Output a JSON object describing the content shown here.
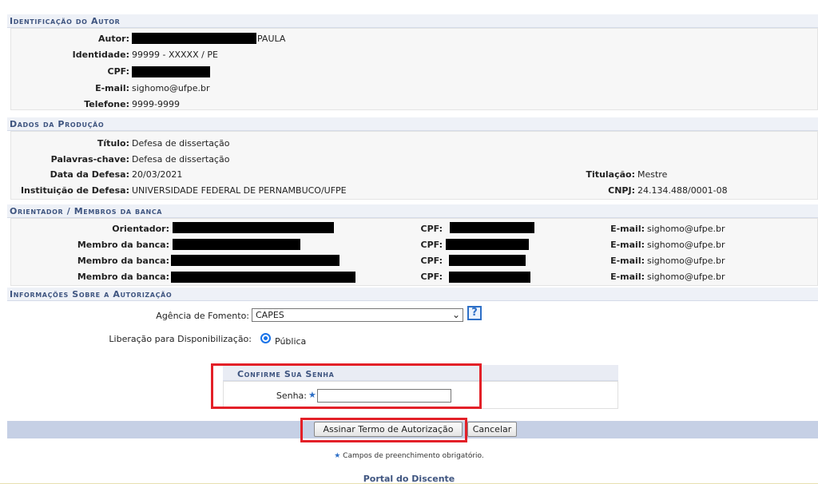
{
  "sections": {
    "author": "Identificação do Autor",
    "production": "Dados da Produção",
    "advisor": "Orientador / Membros da banca",
    "authorization": "Informações Sobre a Autorização"
  },
  "author": {
    "autor_label": "Autor:",
    "autor_value": "PAULA",
    "identidade_label": "Identidade:",
    "identidade_value": "99999 - XXXXX / PE",
    "cpf_label": "CPF:",
    "email_label": "E-mail:",
    "email_value": "sighomo@ufpe.br",
    "telefone_label": "Telefone:",
    "telefone_value": "9999-9999"
  },
  "production": {
    "titulo_label": "Título:",
    "titulo_value": "Defesa de dissertação",
    "palavras_label": "Palavras-chave:",
    "palavras_value": "Defesa de dissertação",
    "data_label": "Data da Defesa:",
    "data_value": "20/03/2021",
    "titulacao_label": "Titulação:",
    "titulacao_value": "Mestre",
    "instituicao_label": "Instituição de Defesa:",
    "instituicao_value": "UNIVERSIDADE FEDERAL DE PERNAMBUCO/UFPE",
    "cnpj_label": "CNPJ:",
    "cnpj_value": "24.134.488/0001-08"
  },
  "members": [
    {
      "role": "Orientador:",
      "cpf_label": "CPF:",
      "email_label": "E-mail:",
      "email": "sighomo@ufpe.br"
    },
    {
      "role": "Membro da banca:",
      "cpf_label": "CPF:",
      "email_label": "E-mail:",
      "email": "sighomo@ufpe.br"
    },
    {
      "role": "Membro da banca:",
      "cpf_label": "CPF:",
      "email_label": "E-mail:",
      "email": "sighomo@ufpe.br"
    },
    {
      "role": "Membro da banca:",
      "cpf_label": "CPF:",
      "email_label": "E-mail:",
      "email": "sighomo@ufpe.br"
    }
  ],
  "authorization": {
    "agencia_label": "Agência de Fomento:",
    "agencia_value": "CAPES",
    "help": "?",
    "liberacao_label": "Liberação para Disponibilização:",
    "liberacao_value": "Pública"
  },
  "password": {
    "title": "Confirme Sua Senha",
    "senha_label": "Senha:",
    "required_mark": "★"
  },
  "actions": {
    "sign_label": "Assinar Termo de Autorização",
    "cancel_label": "Cancelar"
  },
  "footer": {
    "required_mark": "★",
    "note": "Campos de preenchimento obrigatório.",
    "portal": "Portal do Discente"
  },
  "colors": {
    "section_header_text": "#3f5580",
    "highlight_border": "#e32028",
    "button_bar": "#c6d0e5"
  }
}
